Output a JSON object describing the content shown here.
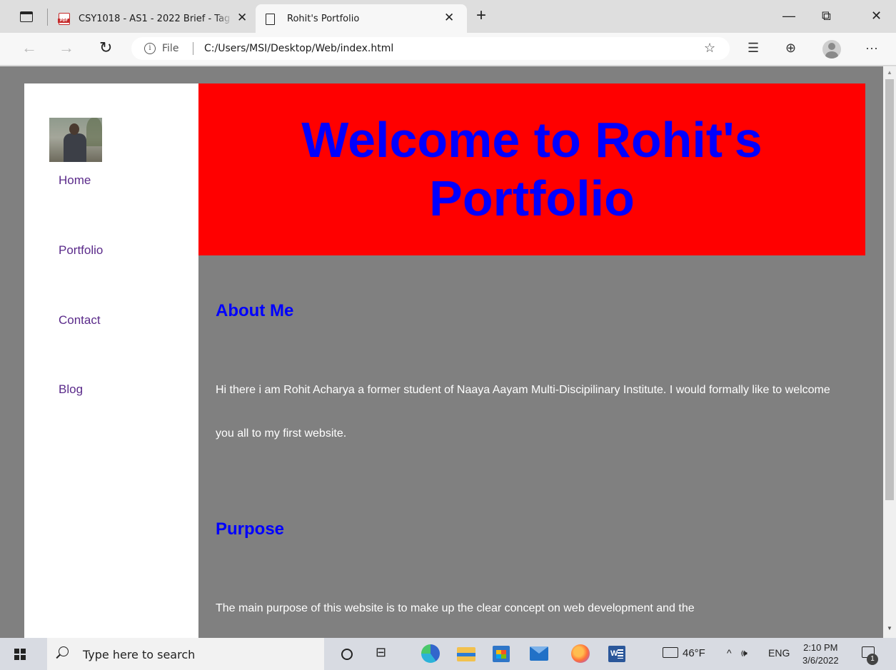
{
  "browser": {
    "tabs": [
      {
        "title": "CSY1018 - AS1 - 2022 Brief - Tag",
        "close": "✕"
      },
      {
        "title": "Rohit's Portfolio",
        "close": "✕"
      }
    ],
    "new_tab": "+",
    "window_controls": {
      "minimize": "—",
      "restore": "⧉",
      "close": "✕"
    },
    "address": {
      "security_label": "File",
      "url": "C:/Users/MSI/Desktop/Web/index.html"
    },
    "nav": {
      "back": "←",
      "forward": "→",
      "reload": "↻"
    },
    "toolbar_icons": {
      "favorites_add": "☆",
      "favorites": "☰",
      "collections": "⊕",
      "more": "···"
    }
  },
  "page": {
    "nav_links": [
      "Home",
      "Portfolio",
      "Contact",
      "Blog"
    ],
    "header_title": "Welcome to Rohit's Portfolio",
    "sections": [
      {
        "title": "About Me",
        "text": "Hi there i am Rohit Acharya a former student of Naaya Aayam Multi-Discipilinary Institute. I would formally like to welcome you all to my first website."
      },
      {
        "title": "Purpose",
        "text": "The main purpose of this website is to make up the clear concept on web development and the"
      }
    ],
    "colors": {
      "header_bg": "#ff0000",
      "heading": "#0000ff",
      "page_bg": "#808080",
      "link": "#5a2a8a"
    }
  },
  "taskbar": {
    "search_placeholder": "Type here to search",
    "weather": "46°F",
    "tray_chevron": "^",
    "volume": "🕪",
    "language": "ENG",
    "time": "2:10 PM",
    "date": "3/6/2022",
    "notification_count": "1",
    "apps": [
      "cortana-icon",
      "task-view-icon",
      "edge-icon",
      "file-explorer-icon",
      "store-icon",
      "mail-icon",
      "firefox-icon",
      "word-icon"
    ]
  }
}
